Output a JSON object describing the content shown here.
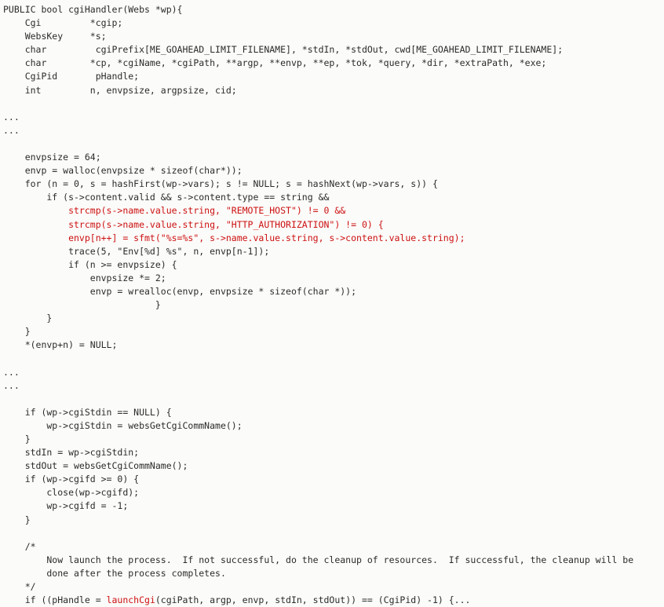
{
  "document": {
    "kind": "source-code-listing",
    "language": "C",
    "function": "cgiHandler",
    "colors": {
      "background": "#fbfbf9",
      "text": "#2b2b2b",
      "highlight": "#cc1111"
    }
  },
  "lines": [
    {
      "text": "PUBLIC bool cgiHandler(Webs *wp){",
      "highlight": false
    },
    {
      "text": "    Cgi         *cgip;",
      "highlight": false
    },
    {
      "text": "    WebsKey     *s;",
      "highlight": false
    },
    {
      "text": "    char         cgiPrefix[ME_GOAHEAD_LIMIT_FILENAME], *stdIn, *stdOut, cwd[ME_GOAHEAD_LIMIT_FILENAME];",
      "highlight": false
    },
    {
      "text": "    char        *cp, *cgiName, *cgiPath, **argp, **envp, **ep, *tok, *query, *dir, *extraPath, *exe;",
      "highlight": false
    },
    {
      "text": "    CgiPid       pHandle;",
      "highlight": false
    },
    {
      "text": "    int         n, envpsize, argpsize, cid;",
      "highlight": false
    },
    {
      "text": "",
      "highlight": false
    },
    {
      "text": "...",
      "highlight": false
    },
    {
      "text": "...",
      "highlight": false
    },
    {
      "text": "",
      "highlight": false
    },
    {
      "text": "    envpsize = 64;",
      "highlight": false
    },
    {
      "text": "    envp = walloc(envpsize * sizeof(char*));",
      "highlight": false
    },
    {
      "text": "    for (n = 0, s = hashFirst(wp->vars); s != NULL; s = hashNext(wp->vars, s)) {",
      "highlight": false
    },
    {
      "text": "        if (s->content.valid && s->content.type == string &&",
      "highlight": false
    },
    {
      "text": "            strcmp(s->name.value.string, \"REMOTE_HOST\") != 0 &&",
      "highlight": true
    },
    {
      "text": "            strcmp(s->name.value.string, \"HTTP_AUTHORIZATION\") != 0) {",
      "highlight": true
    },
    {
      "text": "            envp[n++] = sfmt(\"%s=%s\", s->name.value.string, s->content.value.string);",
      "highlight": true
    },
    {
      "text": "            trace(5, \"Env[%d] %s\", n, envp[n-1]);",
      "highlight": false
    },
    {
      "text": "            if (n >= envpsize) {",
      "highlight": false
    },
    {
      "text": "                envpsize *= 2;",
      "highlight": false
    },
    {
      "text": "                envp = wrealloc(envp, envpsize * sizeof(char *));",
      "highlight": false
    },
    {
      "text": "                            }",
      "highlight": false
    },
    {
      "text": "        }",
      "highlight": false
    },
    {
      "text": "    }",
      "highlight": false
    },
    {
      "text": "    *(envp+n) = NULL;",
      "highlight": false
    },
    {
      "text": "",
      "highlight": false
    },
    {
      "text": "...",
      "highlight": false
    },
    {
      "text": "...",
      "highlight": false
    },
    {
      "text": "",
      "highlight": false
    },
    {
      "text": "    if (wp->cgiStdin == NULL) {",
      "highlight": false
    },
    {
      "text": "        wp->cgiStdin = websGetCgiCommName();",
      "highlight": false
    },
    {
      "text": "    }",
      "highlight": false
    },
    {
      "text": "    stdIn = wp->cgiStdin;",
      "highlight": false
    },
    {
      "text": "    stdOut = websGetCgiCommName();",
      "highlight": false
    },
    {
      "text": "    if (wp->cgifd >= 0) {",
      "highlight": false
    },
    {
      "text": "        close(wp->cgifd);",
      "highlight": false
    },
    {
      "text": "        wp->cgifd = -1;",
      "highlight": false
    },
    {
      "text": "    }",
      "highlight": false
    },
    {
      "text": "",
      "highlight": false
    },
    {
      "text": "    /*",
      "highlight": false
    },
    {
      "text": "        Now launch the process.  If not successful, do the cleanup of resources.  If successful, the cleanup will be",
      "highlight": false
    },
    {
      "text": "        done after the process completes.",
      "highlight": false
    },
    {
      "text": "    */",
      "highlight": false
    },
    {
      "text": "    if ((pHandle = ",
      "highlight": false,
      "token": "launchCgi",
      "after": "(cgiPath, argp, envp, stdIn, stdOut)) == (CgiPid) -1) {..."
    }
  ]
}
